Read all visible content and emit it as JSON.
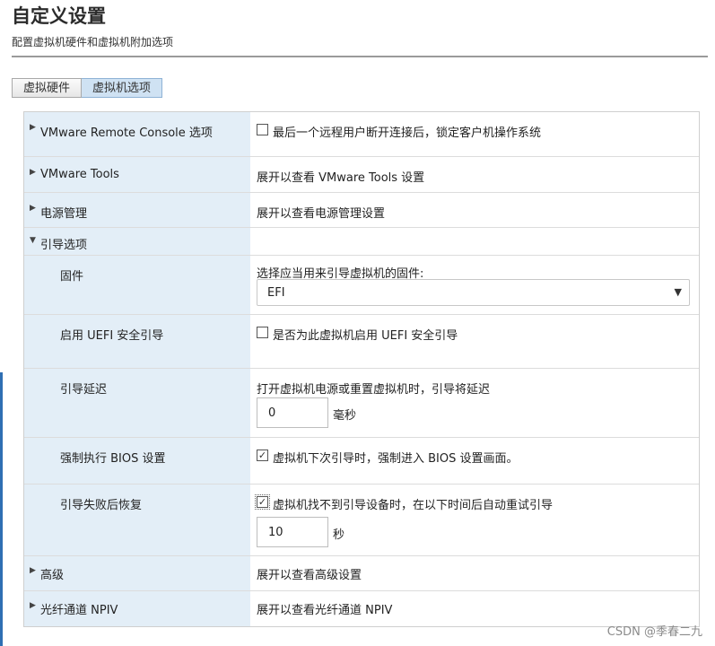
{
  "header": {
    "title": "自定义设置",
    "subtitle": "配置虚拟机硬件和虚拟机附加选项"
  },
  "tabs": [
    {
      "label": "虚拟硬件",
      "active": false
    },
    {
      "label": "虚拟机选项",
      "active": true
    }
  ],
  "rows": {
    "remote_console": {
      "label": "VMware Remote Console 选项",
      "expanded": false,
      "checkbox_checked": false,
      "checkbox_label": "最后一个远程用户断开连接后，锁定客户机操作系统"
    },
    "vmware_tools": {
      "label": "VMware Tools",
      "expanded": false,
      "value": "展开以查看 VMware Tools 设置"
    },
    "power_mgmt": {
      "label": "电源管理",
      "expanded": false,
      "value": "展开以查看电源管理设置"
    },
    "boot_options": {
      "label": "引导选项",
      "expanded": true
    },
    "firmware": {
      "label": "固件",
      "prompt": "选择应当用来引导虚拟机的固件:",
      "selected": "EFI"
    },
    "uefi_secure_boot": {
      "label": "启用 UEFI 安全引导",
      "checkbox_checked": false,
      "checkbox_label": "是否为此虚拟机启用 UEFI 安全引导"
    },
    "boot_delay": {
      "label": "引导延迟",
      "description": "打开虚拟机电源或重置虚拟机时，引导将延迟",
      "value": "0",
      "unit": "毫秒"
    },
    "force_bios": {
      "label": "强制执行 BIOS 设置",
      "checkbox_checked": true,
      "checkbox_label": "虚拟机下次引导时，强制进入 BIOS 设置画面。"
    },
    "boot_retry": {
      "label": "引导失败后恢复",
      "checkbox_checked": true,
      "checkbox_label": "虚拟机找不到引导设备时，在以下时间后自动重试引导",
      "value": "10",
      "unit": "秒"
    },
    "advanced": {
      "label": "高级",
      "expanded": false,
      "value": "展开以查看高级设置"
    },
    "npiv": {
      "label": "光纤通道 NPIV",
      "expanded": false,
      "value": "展开以查看光纤通道 NPIV"
    }
  },
  "icons": {
    "collapsed": "triangle-right-icon",
    "expanded": "triangle-down-icon",
    "dropdown": "caret-down-icon",
    "check": "checkmark-icon"
  },
  "watermark": "CSDN @季春二九",
  "colors": {
    "label_column_bg": "#e3eef7",
    "active_tab_bg": "#cfe2f3",
    "accent": "#2f6fb3"
  }
}
